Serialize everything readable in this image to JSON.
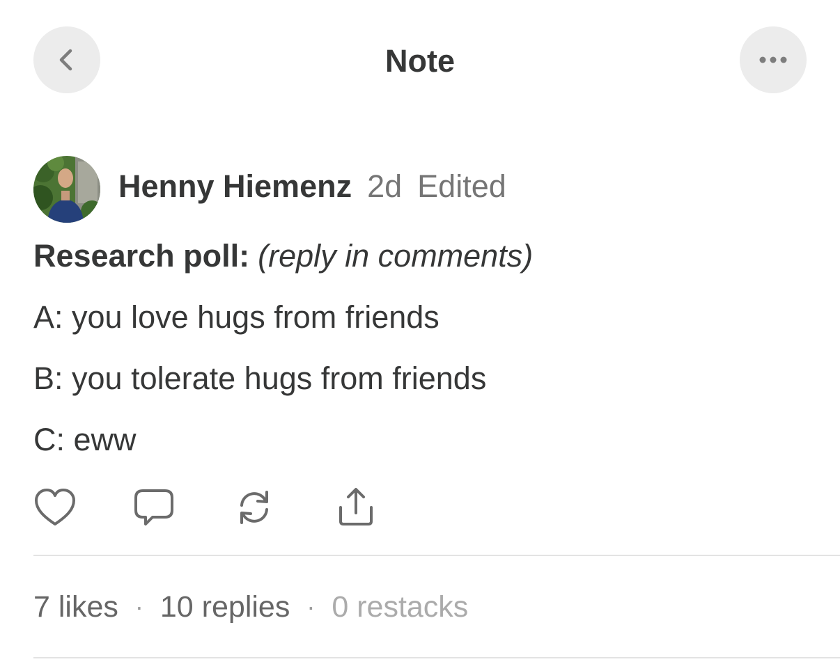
{
  "header": {
    "title": "Note",
    "back_icon": "chevron-left-icon",
    "more_icon": "more-horizontal-icon"
  },
  "post": {
    "author": {
      "name": "Henny Hiemenz",
      "time": "2d",
      "edited_label": "Edited",
      "avatar_icon": "avatar-photo"
    },
    "heading_bold": "Research poll:",
    "heading_italic": "(reply in comments)",
    "options": [
      "A: you love hugs from friends",
      "B: you tolerate hugs from friends",
      "C: eww"
    ]
  },
  "actions": [
    {
      "name": "like",
      "icon": "heart-icon"
    },
    {
      "name": "reply",
      "icon": "comment-icon"
    },
    {
      "name": "restack",
      "icon": "refresh-icon"
    },
    {
      "name": "share",
      "icon": "share-icon"
    }
  ],
  "stats": {
    "likes": "7 likes",
    "replies": "10 replies",
    "restacks": "0 restacks",
    "separator": "·"
  },
  "colors": {
    "text_primary": "#363737",
    "text_secondary": "#757575",
    "text_muted": "#ababab",
    "button_bg": "#ececec",
    "divider": "#e3e3e3"
  }
}
